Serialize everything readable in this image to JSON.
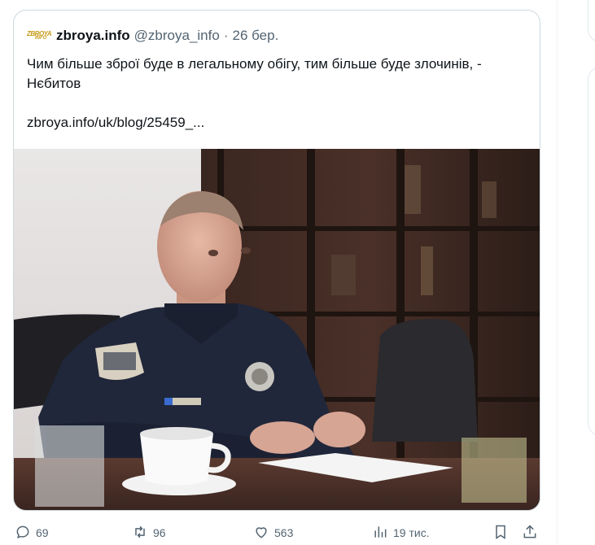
{
  "quote": {
    "author_name": "zbroya.info",
    "author_handle": "@zbroya_info",
    "separator": "·",
    "date": "26 бер.",
    "avatar_text_top": "ZBROYA",
    "avatar_text_bottom": "INFO",
    "text_line1": "Чим більше зброї буде в легальному обігу, тим більше буде злочинів, -",
    "text_line2": "Нєбитов",
    "link": "zbroya.info/uk/blog/25459_...",
    "image_badge": "ПОЛІЦІЯ"
  },
  "actions": {
    "replies": "69",
    "reposts": "96",
    "likes": "563",
    "views": "19 тис."
  },
  "colors": {
    "text_primary": "#0f1419",
    "text_secondary": "#536471",
    "border": "#cfd9de"
  }
}
